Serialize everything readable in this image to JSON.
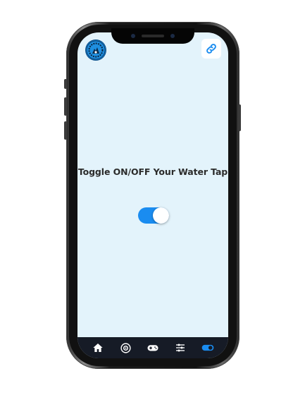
{
  "app": {
    "logo_icon": "company-logo-icon",
    "link_icon": "link-icon"
  },
  "main": {
    "title": "Toggle ON/OFF Your Water Tap",
    "toggle_state": "on"
  },
  "bottom_nav": {
    "items": [
      {
        "icon": "home-icon"
      },
      {
        "icon": "eye-icon"
      },
      {
        "icon": "gamepad-icon"
      },
      {
        "icon": "sliders-icon"
      },
      {
        "icon": "toggle-icon",
        "active": true
      }
    ]
  },
  "colors": {
    "accent": "#1a8cf0",
    "screen_bg": "#e3f3fb",
    "nav_bg": "#161b26",
    "active_icon": "#1a8cf0",
    "inactive_icon": "#ffffff"
  }
}
